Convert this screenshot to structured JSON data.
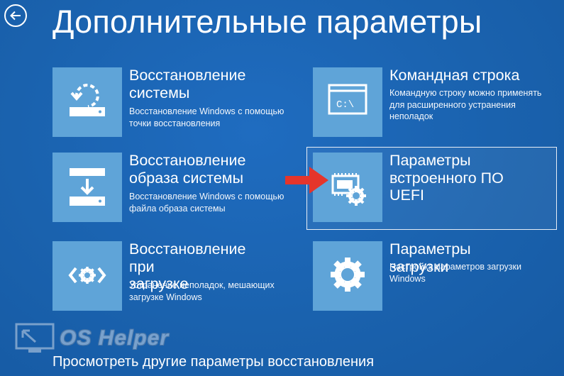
{
  "page": {
    "title": "Дополнительные параметры",
    "back_icon": "back-arrow-icon"
  },
  "options": [
    {
      "title": "Восстановление\nсистемы",
      "description": "Восстановление Windows с помощью\nточки восстановления",
      "icon": "system-restore-icon"
    },
    {
      "title": "Командная строка",
      "description": "Командную строку можно применять\nдля расширенного устранения\nнеполадок",
      "icon": "command-prompt-icon",
      "icon_text": "C:\\"
    },
    {
      "title": "Восстановление\nобраза системы",
      "description": "Восстановление Windows с помощью\nфайла образа системы",
      "icon": "system-image-icon"
    },
    {
      "title": "Параметры\nвстроенного ПО\nUEFI",
      "description": "",
      "icon": "uefi-settings-icon",
      "selected": true
    },
    {
      "title": "Восстановление при\nзагрузке",
      "description": "Устранение неполадок, мешающих\nзагрузке Windows",
      "icon": "startup-repair-icon"
    },
    {
      "title": "Параметры загрузки",
      "description": "Настройка параметров загрузки\nWindows",
      "icon": "startup-settings-gear-icon"
    }
  ],
  "footer": {
    "link_label": "Просмотреть другие параметры восстановления"
  },
  "overlay": {
    "arrow": "red-pointer-arrow-icon",
    "watermark_text": "OS Helper"
  },
  "colors": {
    "background": "#1863b0",
    "tile": "#5fa4d8",
    "arrow": "#e5352b",
    "text": "#ffffff"
  }
}
